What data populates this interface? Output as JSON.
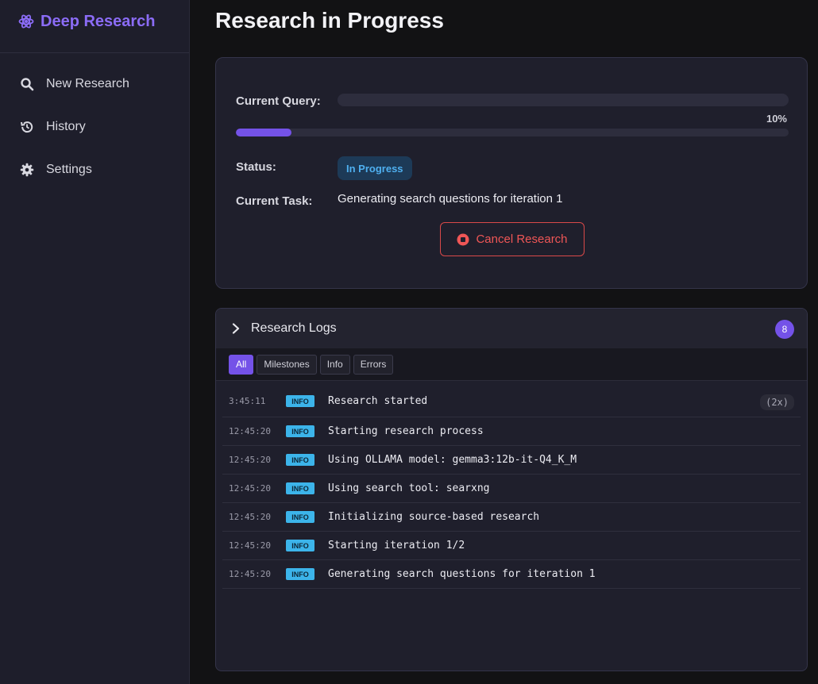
{
  "sidebar": {
    "brand": "Deep Research",
    "items": [
      {
        "label": "New Research",
        "icon": "search-icon"
      },
      {
        "label": "History",
        "icon": "history-icon"
      },
      {
        "label": "Settings",
        "icon": "gear-icon"
      }
    ]
  },
  "main": {
    "title": "Research in Progress",
    "card": {
      "query_label": "Current Query:",
      "query_value": "",
      "progress_text": "10%",
      "progress_value": 10,
      "status_label": "Status:",
      "status_value": "In Progress",
      "task_label": "Current Task:",
      "task_value": "Generating search questions for iteration 1",
      "cancel_label": "Cancel Research"
    },
    "logs": {
      "title": "Research Logs",
      "count": "8",
      "filters": [
        "All",
        "Milestones",
        "Info",
        "Errors"
      ],
      "active_filter": "All",
      "entries": [
        {
          "time": "3:45:11",
          "level": "INFO",
          "message": "Research started",
          "repeat": "(2x)"
        },
        {
          "time": "12:45:20",
          "level": "INFO",
          "message": "Starting research process",
          "repeat": ""
        },
        {
          "time": "12:45:20",
          "level": "INFO",
          "message": "Using OLLAMA model: gemma3:12b-it-Q4_K_M",
          "repeat": ""
        },
        {
          "time": "12:45:20",
          "level": "INFO",
          "message": "Using search tool: searxng",
          "repeat": ""
        },
        {
          "time": "12:45:20",
          "level": "INFO",
          "message": "Initializing source-based research",
          "repeat": ""
        },
        {
          "time": "12:45:20",
          "level": "INFO",
          "message": "Starting iteration 1/2",
          "repeat": ""
        },
        {
          "time": "12:45:20",
          "level": "INFO",
          "message": "Generating search questions for iteration 1",
          "repeat": ""
        }
      ]
    }
  },
  "colors": {
    "accent": "#7452e8",
    "brand": "#8b6cf6",
    "info_badge": "#3cb4ea",
    "danger": "#ef5656",
    "status_badge_bg": "#1d3a57",
    "status_badge_text": "#4fb0f0"
  }
}
